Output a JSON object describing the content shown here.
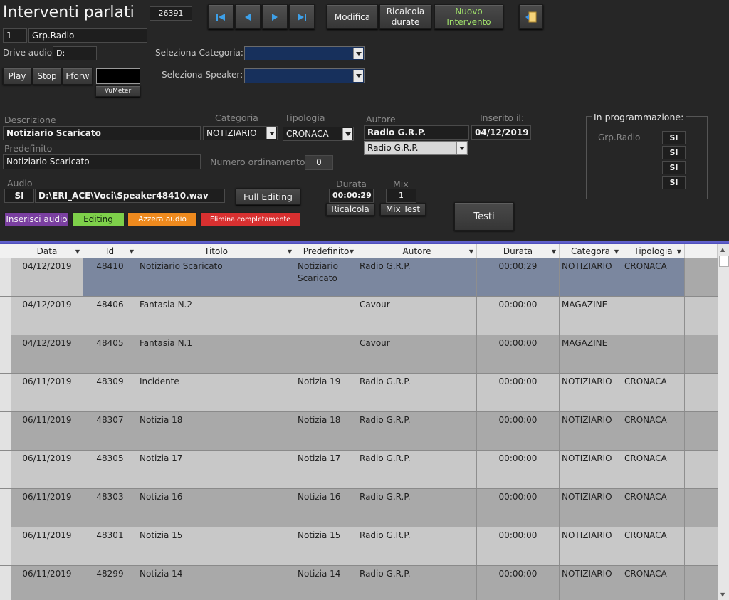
{
  "header": {
    "title": "Interventi parlati",
    "record_id": "26391",
    "group_number": "1",
    "group_name": "Grp.Radio"
  },
  "nav": {
    "modifica": "Modifica",
    "ricalcola_line1": "Ricalcola",
    "ricalcola_line2": "durate",
    "nuovo_line1": "Nuovo",
    "nuovo_line2": "Intervento"
  },
  "audio_controls": {
    "drive_label": "Drive audio:",
    "drive_value": "D:",
    "play": "Play",
    "stop": "Stop",
    "fforw": "Fforw",
    "vumeter": "VuMeter"
  },
  "filters": {
    "categoria_label": "Seleziona Categoria:",
    "speaker_label": "Seleziona Speaker:"
  },
  "detail": {
    "descrizione_label": "Descrizione",
    "descrizione_value": "Notiziario Scaricato",
    "categoria_label": "Categoria",
    "categoria_value": "NOTIZIARIO",
    "tipologia_label": "Tipologia",
    "tipologia_value": "CRONACA",
    "autore_label": "Autore",
    "autore_value": "Radio G.R.P.",
    "autore_select": "Radio G.R.P.",
    "inserito_label": "Inserito il:",
    "inserito_value": "04/12/2019",
    "predefinito_label": "Predefinito",
    "predefinito_value": "Notiziario Scaricato",
    "numero_label": "Numero ordinamento:",
    "numero_value": "0",
    "audio_label": "Audio",
    "audio_si": "SI",
    "audio_path": "D:\\ERI_ACE\\Voci\\Speaker48410.wav",
    "full_editing": "Full Editing",
    "durata_label": "Durata",
    "durata_value": "00:00:29",
    "mix_label": "Mix",
    "mix_value": "1",
    "ricalcola": "Ricalcola",
    "mix_test": "Mix Test",
    "testi": "Testi",
    "inserisci": "Inserisci audio",
    "editing": "Editing",
    "azzera": "Azzera audio",
    "elimina": "Elimina completamente"
  },
  "programmazione": {
    "title": "In programmazione:",
    "group": "Grp.Radio",
    "values": [
      "SI",
      "SI",
      "SI",
      "SI"
    ]
  },
  "grid": {
    "columns": [
      "Data",
      "Id",
      "Titolo",
      "Predefinito",
      "Autore",
      "Durata",
      "Categora",
      "Tipologia"
    ],
    "rows": [
      [
        "04/12/2019",
        "48410",
        "Notiziario Scaricato",
        "Notiziario Scaricato",
        "Radio G.R.P.",
        "00:00:29",
        "NOTIZIARIO",
        "CRONACA"
      ],
      [
        "04/12/2019",
        "48406",
        "Fantasia N.2",
        "",
        "Cavour",
        "00:00:00",
        "MAGAZINE",
        ""
      ],
      [
        "04/12/2019",
        "48405",
        "Fantasia N.1",
        "",
        "Cavour",
        "00:00:00",
        "MAGAZINE",
        ""
      ],
      [
        "06/11/2019",
        "48309",
        "Incidente",
        "Notizia 19",
        "Radio G.R.P.",
        "00:00:00",
        "NOTIZIARIO",
        "CRONACA"
      ],
      [
        "06/11/2019",
        "48307",
        "Notizia 18",
        "Notizia 18",
        "Radio G.R.P.",
        "00:00:00",
        "NOTIZIARIO",
        "CRONACA"
      ],
      [
        "06/11/2019",
        "48305",
        "Notizia 17",
        "Notizia 17",
        "Radio G.R.P.",
        "00:00:00",
        "NOTIZIARIO",
        "CRONACA"
      ],
      [
        "06/11/2019",
        "48303",
        "Notizia 16",
        "Notizia 16",
        "Radio G.R.P.",
        "00:00:00",
        "NOTIZIARIO",
        "CRONACA"
      ],
      [
        "06/11/2019",
        "48301",
        "Notizia 15",
        "Notizia 15",
        "Radio G.R.P.",
        "00:00:00",
        "NOTIZIARIO",
        "CRONACA"
      ],
      [
        "06/11/2019",
        "48299",
        "Notizia 14",
        "Notizia 14",
        "Radio G.R.P.",
        "00:00:00",
        "NOTIZIARIO",
        "CRONACA"
      ]
    ]
  },
  "colors": {
    "background": "#262626",
    "nuovo_text": "#9fe06a",
    "inserisci": "#7a3fa0",
    "editing": "#7ed04a",
    "azzera": "#ee8a1e",
    "elimina": "#d83030",
    "selected_row": "#7b879f"
  }
}
